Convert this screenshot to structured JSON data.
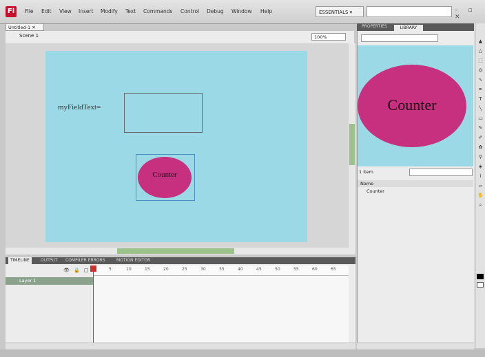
{
  "menubar": {
    "logo": "Fl",
    "items": [
      "File",
      "Edit",
      "View",
      "Insert",
      "Modify",
      "Text",
      "Commands",
      "Control",
      "Debug",
      "Window",
      "Help"
    ],
    "workspace": "ESSENTIALS ▾",
    "window_buttons": "– ▫ ✕"
  },
  "document": {
    "tab_label": "Untitled-1 ✕",
    "scene_label": "Scene 1",
    "zoom": "100%"
  },
  "stage": {
    "field_label": "myFieldText=",
    "button_label": "Counter"
  },
  "timeline": {
    "tabs": [
      "TIMELINE",
      "OUTPUT",
      "COMPILER ERRORS",
      "MOTION EDITOR"
    ],
    "layer_name": "Layer 1",
    "header_icons": "👁 🔒 □",
    "frame_numbers": [
      "5",
      "10",
      "15",
      "20",
      "25",
      "30",
      "35",
      "40",
      "45",
      "50",
      "55",
      "60",
      "65"
    ]
  },
  "library": {
    "tabs": [
      "PROPERTIES",
      "LIBRARY"
    ],
    "preview_label": "Counter",
    "item_count": "1 item",
    "header": "Name",
    "item_name": "Counter"
  },
  "colors": {
    "stage": "#9cd9e6",
    "button_fill": "#c7307f",
    "layer_highlight": "#8ba28c",
    "playhead": "#d0302a"
  }
}
